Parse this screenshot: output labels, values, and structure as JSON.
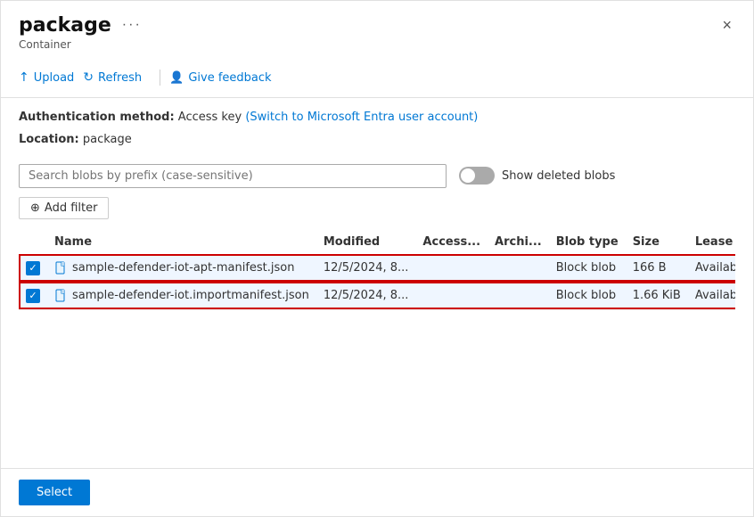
{
  "panel": {
    "title": "package",
    "subtitle": "Container",
    "close_label": "×",
    "ellipsis_label": "···"
  },
  "toolbar": {
    "upload_label": "Upload",
    "refresh_label": "Refresh",
    "feedback_label": "Give feedback"
  },
  "auth": {
    "method_label": "Authentication method:",
    "method_value": "Access key",
    "link_text": "(Switch to Microsoft Entra user account)",
    "location_label": "Location:",
    "location_value": "package"
  },
  "search": {
    "placeholder": "Search blobs by prefix (case-sensitive)",
    "deleted_blobs_label": "Show deleted blobs"
  },
  "filter": {
    "add_label": "Add filter"
  },
  "table": {
    "columns": [
      "Name",
      "Modified",
      "Access...",
      "Archi...",
      "Blob type",
      "Size",
      "Lease state"
    ],
    "rows": [
      {
        "name": "sample-defender-iot-apt-manifest.json",
        "modified": "12/5/2024, 8...",
        "access": "",
        "archive": "",
        "blob_type": "Block blob",
        "size": "166 B",
        "lease_state": "Available",
        "checked": true
      },
      {
        "name": "sample-defender-iot.importmanifest.json",
        "modified": "12/5/2024, 8...",
        "access": "",
        "archive": "",
        "blob_type": "Block blob",
        "size": "1.66 KiB",
        "lease_state": "Available",
        "checked": true
      }
    ]
  },
  "footer": {
    "select_label": "Select"
  }
}
